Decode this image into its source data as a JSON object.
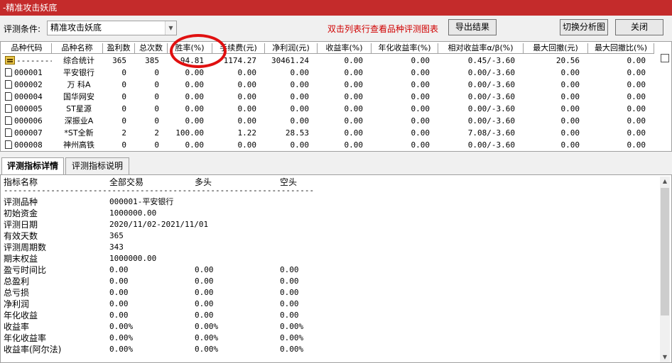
{
  "window": {
    "title": "-精准攻击妖底"
  },
  "toolbar": {
    "condition_label": "评测条件:",
    "condition_value": "精准攻击妖底",
    "hint": "双击列表行查看品种评测图表",
    "export_label": "导出结果",
    "switch_label": "切换分析图",
    "close_label": "关闭"
  },
  "grid": {
    "headers": [
      "品种代码",
      "品种名称",
      "盈利数",
      "总次数",
      "胜率(%)",
      "手续费(元)",
      "净利润(元)",
      "收益率(%)",
      "年化收益率(%)",
      "相对收益率α/β(%)",
      "最大回撤(元)",
      "最大回撤比(%)"
    ],
    "rows": [
      [
        "--------",
        "综合统计",
        "365",
        "385",
        "94.81",
        "1174.27",
        "30461.24",
        "0.00",
        "0.00",
        "0.45/-3.60",
        "20.56",
        "0.00"
      ],
      [
        "000001",
        "平安银行",
        "0",
        "0",
        "0.00",
        "0.00",
        "0.00",
        "0.00",
        "0.00",
        "0.00/-3.60",
        "0.00",
        "0.00"
      ],
      [
        "000002",
        "万 科A",
        "0",
        "0",
        "0.00",
        "0.00",
        "0.00",
        "0.00",
        "0.00",
        "0.00/-3.60",
        "0.00",
        "0.00"
      ],
      [
        "000004",
        "国华网安",
        "0",
        "0",
        "0.00",
        "0.00",
        "0.00",
        "0.00",
        "0.00",
        "0.00/-3.60",
        "0.00",
        "0.00"
      ],
      [
        "000005",
        "ST星源",
        "0",
        "0",
        "0.00",
        "0.00",
        "0.00",
        "0.00",
        "0.00",
        "0.00/-3.60",
        "0.00",
        "0.00"
      ],
      [
        "000006",
        "深振业A",
        "0",
        "0",
        "0.00",
        "0.00",
        "0.00",
        "0.00",
        "0.00",
        "0.00/-3.60",
        "0.00",
        "0.00"
      ],
      [
        "000007",
        "*ST全新",
        "2",
        "2",
        "100.00",
        "1.22",
        "28.53",
        "0.00",
        "0.00",
        "7.08/-3.60",
        "0.00",
        "0.00"
      ],
      [
        "000008",
        "神州高铁",
        "0",
        "0",
        "0.00",
        "0.00",
        "0.00",
        "0.00",
        "0.00",
        "0.00/-3.60",
        "0.00",
        "0.00"
      ]
    ]
  },
  "tabs": {
    "detail": "评测指标详情",
    "explain": "评测指标说明"
  },
  "detail": {
    "header": {
      "name": "指标名称",
      "all": "全部交易",
      "long": "多头",
      "short": "空头"
    },
    "separator": "------------------------------------------------------------------------------------------------------",
    "lines": [
      {
        "name": "评测品种",
        "all": "000001-平安银行",
        "long": "",
        "short": ""
      },
      {
        "name": "初始资金",
        "all": "1000000.00",
        "long": "",
        "short": ""
      },
      {
        "name": "评测日期",
        "all": "2020/11/02-2021/11/01",
        "long": "",
        "short": ""
      },
      {
        "name": "有效天数",
        "all": "365",
        "long": "",
        "short": ""
      },
      {
        "name": "评测周期数",
        "all": "343",
        "long": "",
        "short": ""
      },
      {
        "name": "期末权益",
        "all": "1000000.00",
        "long": "",
        "short": ""
      },
      {
        "name": "盈亏时间比",
        "all": "0.00",
        "long": "0.00",
        "short": "0.00"
      },
      {
        "name": "总盈利",
        "all": "0.00",
        "long": "0.00",
        "short": "0.00"
      },
      {
        "name": "总亏损",
        "all": "0.00",
        "long": "0.00",
        "short": "0.00"
      },
      {
        "name": "净利润",
        "all": "0.00",
        "long": "0.00",
        "short": "0.00"
      },
      {
        "name": "年化收益",
        "all": "0.00",
        "long": "0.00",
        "short": "0.00"
      },
      {
        "name": "收益率",
        "all": "0.00%",
        "long": "0.00%",
        "short": "0.00%"
      },
      {
        "name": "年化收益率",
        "all": "0.00%",
        "long": "0.00%",
        "short": "0.00%"
      },
      {
        "name": "收益率(阿尔法)",
        "all": "0.00%",
        "long": "0.00%",
        "short": "0.00%"
      }
    ]
  }
}
